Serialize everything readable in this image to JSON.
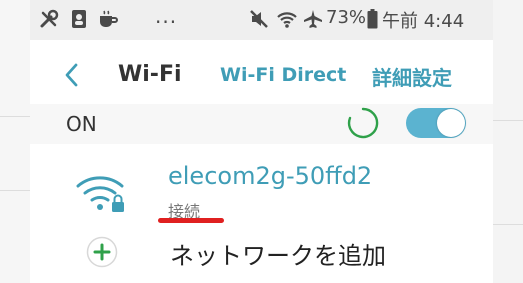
{
  "status_bar": {
    "left_icons": [
      "tools-icon",
      "contacts-icon",
      "cup-icon"
    ],
    "more": "...",
    "right_icons": [
      "mute-icon",
      "wifi-signal-icon",
      "airplane-icon"
    ],
    "battery_percent": "73%",
    "time": "午前 4:44"
  },
  "header": {
    "back_icon": "chevron-left-icon",
    "title": "Wi-Fi",
    "wifi_direct": "Wi-Fi Direct",
    "advanced": "詳細設定"
  },
  "power": {
    "label": "ON",
    "toggle_on": true,
    "accent": "#5bb3d0"
  },
  "network": {
    "name": "elecom2g-50ffd2",
    "status": "接続",
    "icon": "wifi-lock-icon",
    "underline_color": "#e02020"
  },
  "add_network": {
    "icon": "plus-circle-icon",
    "label": "ネットワークを追加"
  },
  "colors": {
    "accent": "#3f9db6",
    "add_green": "#2fa14a"
  }
}
